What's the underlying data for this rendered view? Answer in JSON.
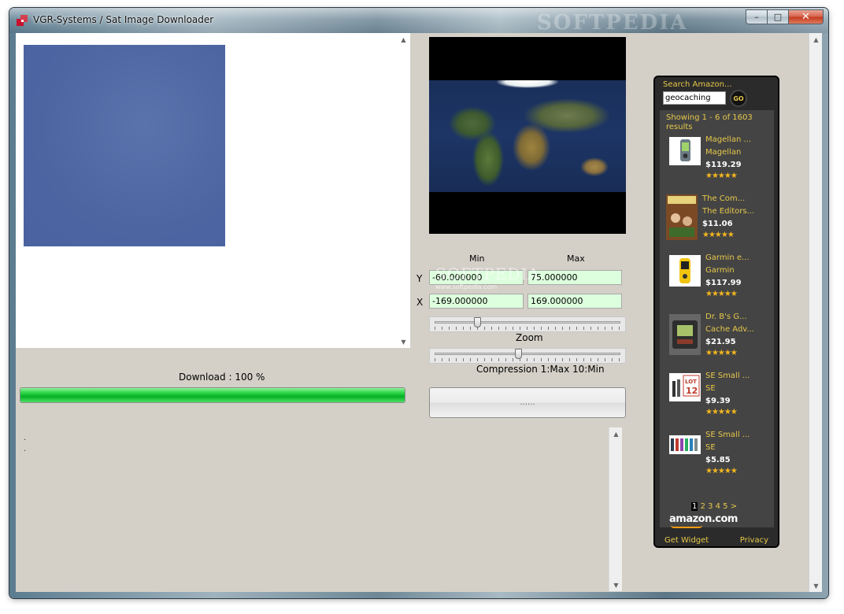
{
  "window": {
    "title": "VGR-Systems / Sat Image Downloader",
    "watermark": "SOFTPEDIA",
    "controls": {
      "minimize": "–",
      "maximize": "□",
      "close": "✕"
    }
  },
  "download": {
    "label": "Download : 100 %",
    "progress_percent": 100
  },
  "log": {
    "lines": [
      ".",
      "."
    ]
  },
  "coords": {
    "min_header": "Min",
    "max_header": "Max",
    "y_label": "Y",
    "x_label": "X",
    "y_min": "-60.000000",
    "y_max": "75.000000",
    "x_min": "-169.000000",
    "x_max": "169.000000"
  },
  "watermark_mid": {
    "brand": "SOFTPEDIA",
    "url": "www.softpedia.com"
  },
  "zoom": {
    "label": "Zoom",
    "level": 0.22
  },
  "compression": {
    "label": "Compression 1:Max 10:Min",
    "level": 0.45
  },
  "action_button": {
    "label": "......"
  },
  "amazon": {
    "search_label": "Search Amazon...",
    "search_value": "geocaching",
    "go_label": "GO",
    "results_text": "Showing 1 - 6 of 1603 results",
    "items": [
      {
        "title": "Magellan ...",
        "brand": "Magellan",
        "price": "$119.29",
        "stars": "★★★★★"
      },
      {
        "title": "The Com...",
        "brand": "The Editors...",
        "price": "$11.06",
        "stars": "★★★★★"
      },
      {
        "title": "Garmin e...",
        "brand": "Garmin",
        "price": "$117.99",
        "stars": "★★★★★"
      },
      {
        "title": "Dr. B's G...",
        "brand": "Cache Adv...",
        "price": "$21.95",
        "stars": "★★★★★"
      },
      {
        "title": "SE Small ...",
        "brand": "SE",
        "price": "$9.39",
        "stars": "★★★★★"
      },
      {
        "title": "SE Small ...",
        "brand": "SE",
        "price": "$5.85",
        "stars": "★★★★★"
      }
    ],
    "pages": {
      "current": "1",
      "others": "2 3 4 5 >"
    },
    "logo": "amazon.com",
    "get_widget": "Get Widget",
    "privacy": "Privacy"
  }
}
